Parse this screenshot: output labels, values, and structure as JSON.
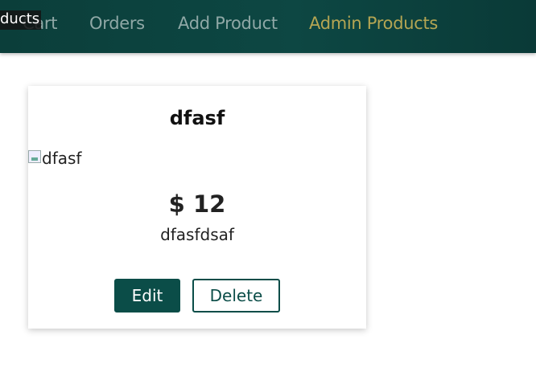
{
  "nav": {
    "items": [
      {
        "label": "Cart"
      },
      {
        "label": "Orders"
      },
      {
        "label": "Add Product"
      },
      {
        "label": "Admin Products"
      }
    ],
    "overlay_text": "ducts"
  },
  "product": {
    "title": "dfasf",
    "image_alt": "dfasf",
    "price": "$ 12",
    "description": "dfasfdsaf",
    "edit_label": "Edit",
    "delete_label": "Delete"
  },
  "colors": {
    "header_bg": "#0d4743",
    "nav_text": "#8fa8a6",
    "nav_active": "#b4a553",
    "primary": "#0b4d48"
  }
}
